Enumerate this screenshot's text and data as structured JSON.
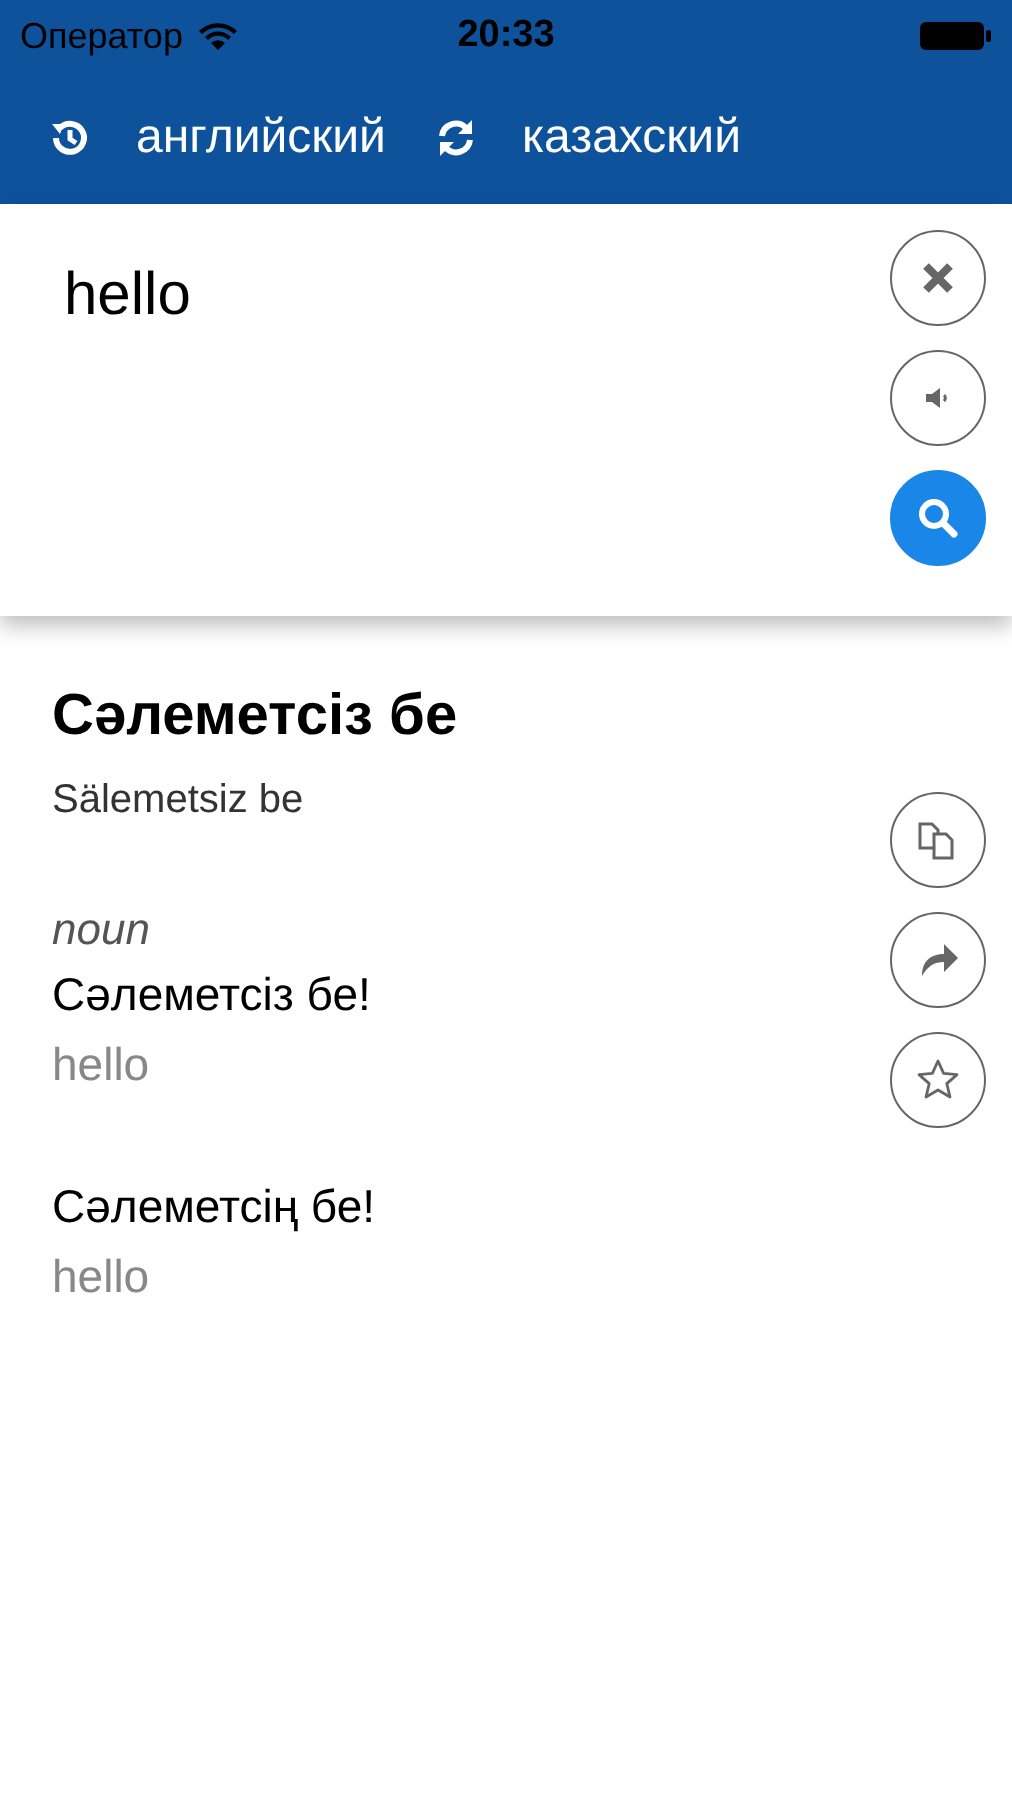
{
  "status_bar": {
    "carrier": "Оператор",
    "time": "20:33"
  },
  "nav": {
    "source_language": "английский",
    "target_language": "казахский"
  },
  "input": {
    "value": "hello"
  },
  "result": {
    "headword": "Сәлеметсіз бе",
    "transliteration": "Sälemetsiz be",
    "senses": [
      {
        "pos": "noun",
        "translation": "Сәлеметсіз бе!",
        "gloss": "hello"
      },
      {
        "translation": "Сәлеметсің бе!",
        "gloss": "hello"
      }
    ]
  }
}
